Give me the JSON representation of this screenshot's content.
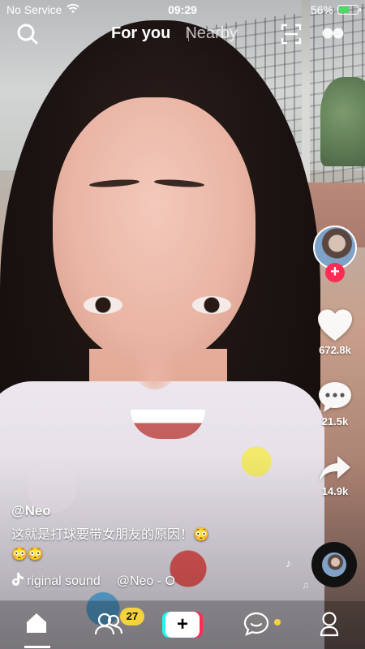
{
  "status_bar": {
    "carrier": "No Service",
    "time": "09:29",
    "battery_percent": "56%",
    "battery_level": 0.56,
    "wifi_icon": "wifi-icon",
    "battery_color": "#4cd964"
  },
  "top_nav": {
    "tabs": [
      {
        "label": "For you",
        "active": true
      },
      {
        "label": "Nearby",
        "active": false
      }
    ],
    "icons": [
      "search-icon",
      "scan-icon",
      "dots-icon"
    ]
  },
  "video": {
    "author": "@Neo",
    "description": "这就是打球要带女朋友的原因！😳",
    "description_extra": "😳😳",
    "music_a": "riginal sound",
    "music_b": "@Neo - O"
  },
  "actions": {
    "likes": "672.8k",
    "comments": "21.5k",
    "shares": "14.9k",
    "follow_symbol": "+",
    "follow_color": "#fe2c55"
  },
  "tab_bar": {
    "badge_count": "27",
    "create_symbol": "+",
    "items": [
      "home-icon",
      "friends-icon",
      "create-button",
      "inbox-icon",
      "profile-icon"
    ],
    "badge_color": "#f5d33f"
  }
}
